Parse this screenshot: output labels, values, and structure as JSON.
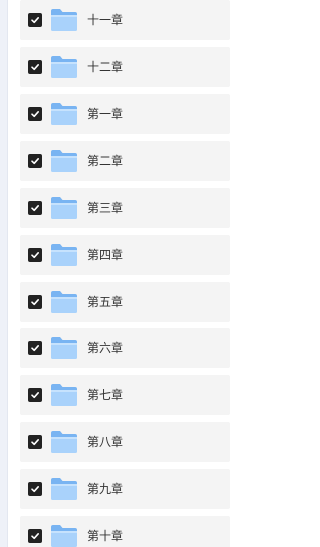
{
  "folders": [
    {
      "label": "十一章",
      "checked": true
    },
    {
      "label": "十二章",
      "checked": true
    },
    {
      "label": "第一章",
      "checked": true
    },
    {
      "label": "第二章",
      "checked": true
    },
    {
      "label": "第三章",
      "checked": true
    },
    {
      "label": "第四章",
      "checked": true
    },
    {
      "label": "第五章",
      "checked": true
    },
    {
      "label": "第六章",
      "checked": true
    },
    {
      "label": "第七章",
      "checked": true
    },
    {
      "label": "第八章",
      "checked": true
    },
    {
      "label": "第九章",
      "checked": true
    },
    {
      "label": "第十章",
      "checked": true
    }
  ],
  "icons": {
    "checkbox": "checkbox-checked-icon",
    "folder": "folder-icon"
  },
  "colors": {
    "row_background": "#f4f4f4",
    "checkbox": "#222222",
    "folder_light": "#a9d2fb",
    "folder_dark": "#79b4f2"
  }
}
